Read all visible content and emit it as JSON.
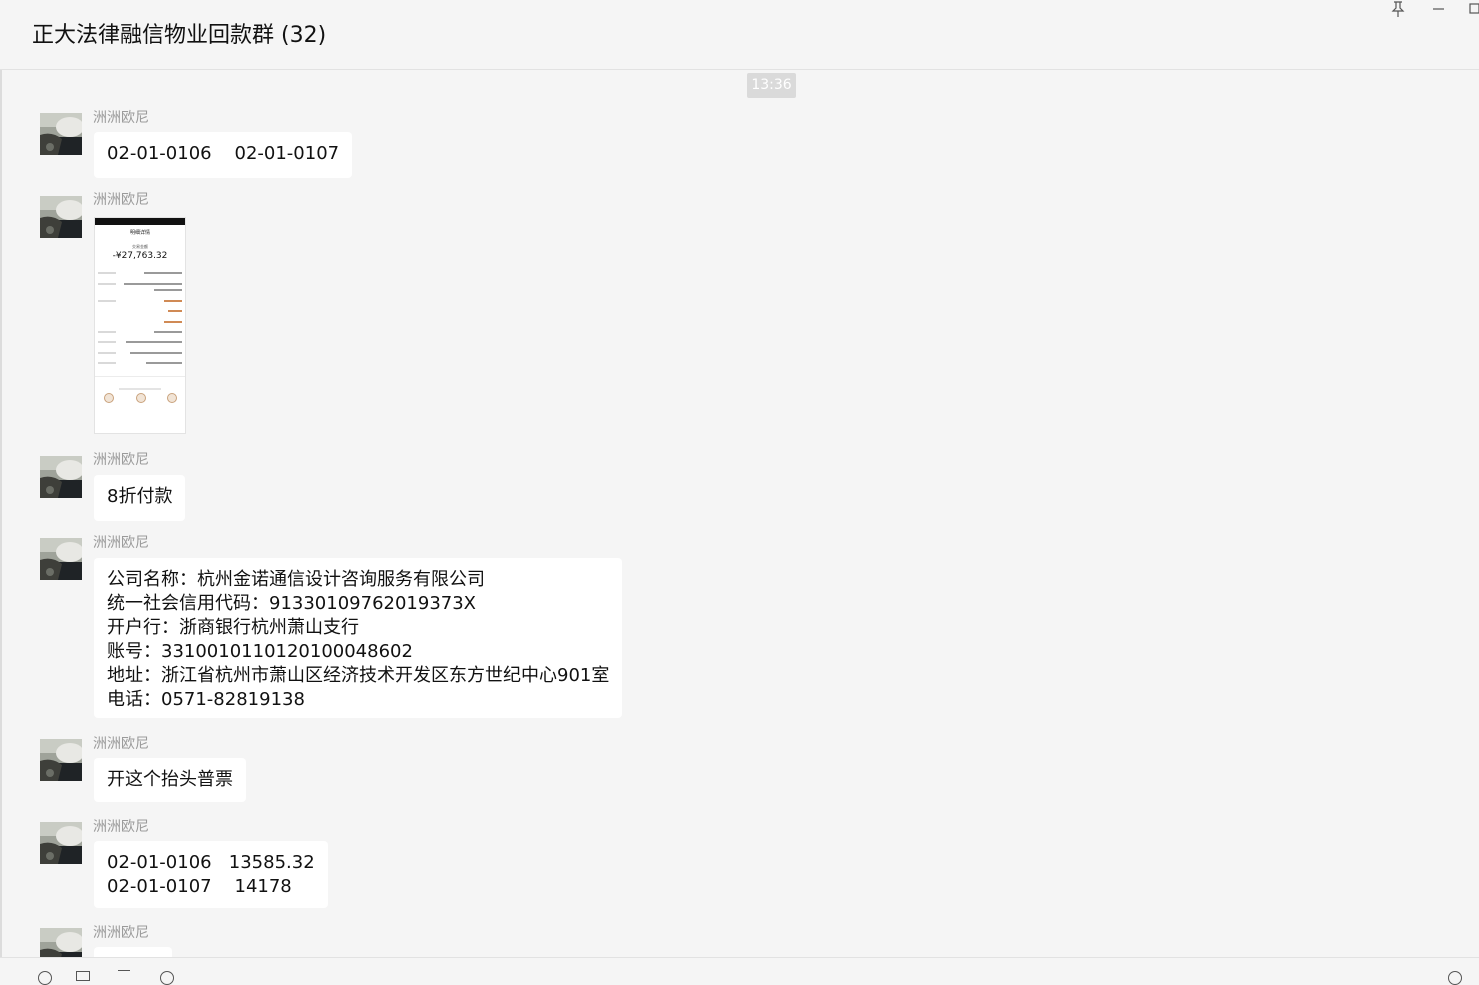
{
  "window": {
    "title": "正大法律融信物业回款群 (32)",
    "pin_icon": "pin-icon",
    "minimize_icon": "minimize-icon",
    "maximize_icon": "maximize-icon"
  },
  "timestamp": "13:36",
  "messages": [
    {
      "sender": "洲洲欧尼",
      "type": "text",
      "text": "02-01-0106    02-01-0107"
    },
    {
      "sender": "洲洲欧尼",
      "type": "image",
      "image": {
        "screen_title": "明细详情",
        "label": "交易金额",
        "amount": "-¥27,763.32"
      }
    },
    {
      "sender": "洲洲欧尼",
      "type": "text",
      "text": "8折付款"
    },
    {
      "sender": "洲洲欧尼",
      "type": "text",
      "text": "公司名称：杭州金诺通信设计咨询服务有限公司\n统一社会信用代码：91330109762019373X\n开户行：浙商银行杭州萧山支行\n账号：3310010110120100048602\n地址：浙江省杭州市萧山区经济技术开发区东方世纪中心901室\n电话：0571-82819138"
    },
    {
      "sender": "洲洲欧尼",
      "type": "text",
      "text": "开这个抬头普票"
    },
    {
      "sender": "洲洲欧尼",
      "type": "text",
      "text": "02-01-0106   13585.32\n02-01-0107    14178"
    },
    {
      "sender": "洲洲欧尼",
      "type": "text",
      "text": ""
    }
  ],
  "colors": {
    "background": "#f5f5f5",
    "bubble": "#ffffff",
    "sender_name": "#9a9a9a",
    "timestamp_bg": "#dadada"
  }
}
